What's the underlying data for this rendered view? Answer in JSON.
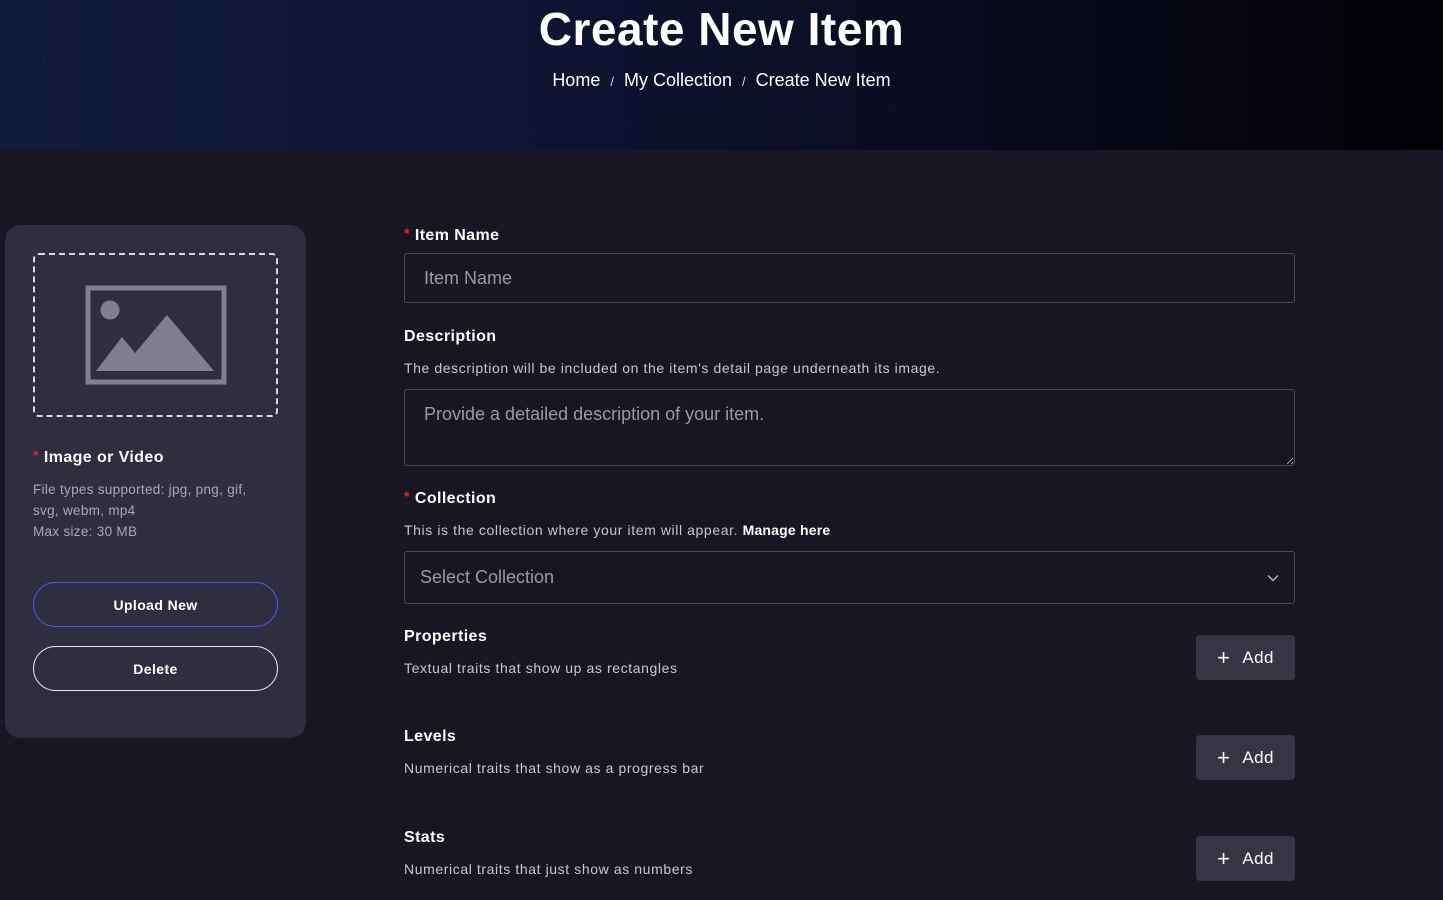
{
  "header": {
    "title": "Create New Item",
    "breadcrumb": [
      {
        "label": "Home",
        "separator": "/"
      },
      {
        "label": "My Collection",
        "separator": "/"
      },
      {
        "label": "Create New Item"
      }
    ]
  },
  "media": {
    "label": "Image or Video",
    "required_mark": "*",
    "help_line1": "File types supported: jpg, png, gif, svg, webm, mp4",
    "help_line2": "Max size: 30 MB",
    "upload_label": "Upload New",
    "delete_label": "Delete",
    "placeholder_icon": "image-placeholder-icon"
  },
  "form": {
    "item_name": {
      "label": "Item Name",
      "required_mark": "*",
      "placeholder": "Item Name",
      "value": ""
    },
    "description": {
      "label": "Description",
      "help": "The description will be included on the item's detail page underneath its image.",
      "placeholder": "Provide a detailed description of your item.",
      "value": ""
    },
    "collection": {
      "label": "Collection",
      "required_mark": "*",
      "help": "This is the collection where your item will appear.",
      "help_link": "Manage here",
      "selected": "Select Collection",
      "icon": "chevron-down-icon"
    },
    "properties": {
      "label": "Properties",
      "help": "Textual traits that show up as rectangles",
      "button_label": "Add",
      "icon": "plus-icon"
    },
    "levels": {
      "label": "Levels",
      "help": "Numerical traits that show as a progress bar",
      "button_label": "Add",
      "icon": "plus-icon"
    },
    "stats": {
      "label": "Stats",
      "help": "Numerical traits that just show as numbers",
      "button_label": "Add",
      "icon": "plus-icon"
    }
  },
  "colors": {
    "page_bg": "#171622",
    "card_bg": "#2f2e40",
    "required": "#e3262d",
    "upload_border": "#5a4ff0",
    "add_button_bg": "#363544"
  }
}
